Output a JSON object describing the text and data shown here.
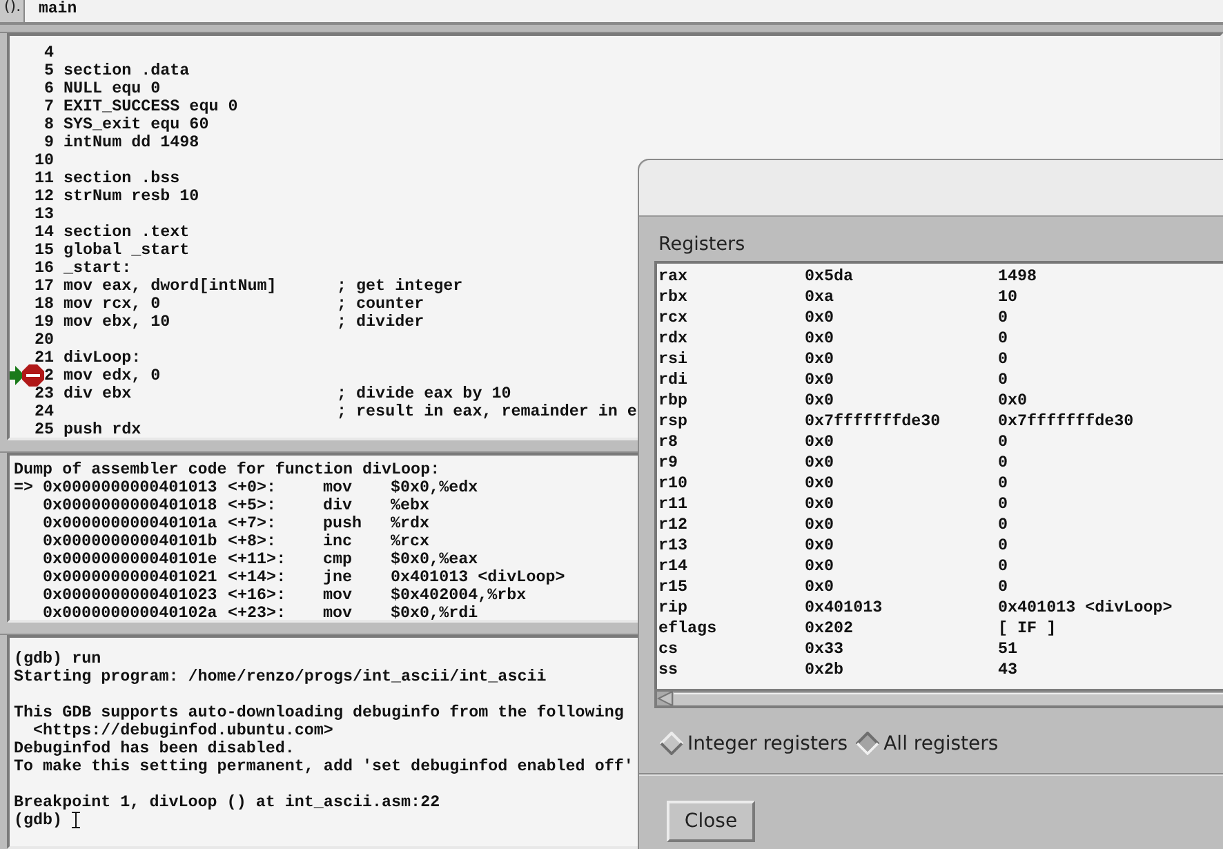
{
  "argument_field": {
    "label": "().",
    "value": "main"
  },
  "source": {
    "lines": [
      {
        "number": "4"
      },
      {
        "number": "5",
        "code": "section .data"
      },
      {
        "number": "6",
        "code": "NULL equ 0"
      },
      {
        "number": "7",
        "code": "EXIT_SUCCESS equ 0"
      },
      {
        "number": "8",
        "code": "SYS_exit equ 60"
      },
      {
        "number": "9",
        "code": "intNum dd 1498"
      },
      {
        "number": "10"
      },
      {
        "number": "11",
        "code": "section .bss"
      },
      {
        "number": "12",
        "code": "strNum resb 10"
      },
      {
        "number": "13"
      },
      {
        "number": "14",
        "code": "section .text"
      },
      {
        "number": "15",
        "code": "global _start"
      },
      {
        "number": "16",
        "code": "_start:"
      },
      {
        "number": "17",
        "code": "mov eax, dword[intNum]",
        "comment": "; get integer"
      },
      {
        "number": "18",
        "code": "mov rcx, 0",
        "comment": "; counter"
      },
      {
        "number": "19",
        "code": "mov ebx, 10",
        "comment": "; divider"
      },
      {
        "number": "20"
      },
      {
        "number": "21",
        "code": "divLoop:"
      },
      {
        "number": "2",
        "code": "mov edx, 0",
        "breakpoint": true,
        "current": true
      },
      {
        "number": "23",
        "code": "div ebx",
        "comment": "; divide eax by 10"
      },
      {
        "number": "24",
        "comment": "; result in eax, remainder in e"
      },
      {
        "number": "25",
        "code": "push rdx"
      }
    ]
  },
  "disassembly": {
    "title": "Dump of assembler code for function divLoop:",
    "lines": [
      {
        "marker": "=>",
        "address": "0x0000000000401013",
        "offset": "<+0>:",
        "mnemonic": "mov",
        "operands": "$0x0,%edx"
      },
      {
        "address": "0x0000000000401018",
        "offset": "<+5>:",
        "mnemonic": "div",
        "operands": "%ebx"
      },
      {
        "address": "0x000000000040101a",
        "offset": "<+7>:",
        "mnemonic": "push",
        "operands": "%rdx"
      },
      {
        "address": "0x000000000040101b",
        "offset": "<+8>:",
        "mnemonic": "inc",
        "operands": "%rcx"
      },
      {
        "address": "0x000000000040101e",
        "offset": "<+11>:",
        "mnemonic": "cmp",
        "operands": "$0x0,%eax"
      },
      {
        "address": "0x0000000000401021",
        "offset": "<+14>:",
        "mnemonic": "jne",
        "operands": "0x401013 <divLoop>"
      },
      {
        "address": "0x0000000000401023",
        "offset": "<+16>:",
        "mnemonic": "mov",
        "operands": "$0x402004,%rbx"
      },
      {
        "address": "0x000000000040102a",
        "offset": "<+23>:",
        "mnemonic": "mov",
        "operands": "$0x0,%rdi"
      }
    ]
  },
  "console": {
    "blocks": [
      [
        "(gdb) run",
        "Starting program: /home/renzo/progs/int_ascii/int_ascii"
      ],
      [
        "This GDB supports auto-downloading debuginfo from the following",
        "  <https://debuginfod.ubuntu.com>",
        "Debuginfod has been disabled.",
        "To make this setting permanent, add 'set debuginfod enabled off'"
      ],
      [
        "Breakpoint 1, divLoop () at int_ascii.asm:22"
      ]
    ],
    "prompt": "(gdb)"
  },
  "registers_dialog": {
    "title": "Registers",
    "rows": [
      [
        "rax",
        "0x5da",
        "1498"
      ],
      [
        "rbx",
        "0xa",
        "10"
      ],
      [
        "rcx",
        "0x0",
        "0"
      ],
      [
        "rdx",
        "0x0",
        "0"
      ],
      [
        "rsi",
        "0x0",
        "0"
      ],
      [
        "rdi",
        "0x0",
        "0"
      ],
      [
        "rbp",
        "0x0",
        "0x0"
      ],
      [
        "rsp",
        "0x7fffffffde30",
        "0x7fffffffde30"
      ],
      [
        "r8",
        "0x0",
        "0"
      ],
      [
        "r9",
        "0x0",
        "0"
      ],
      [
        "r10",
        "0x0",
        "0"
      ],
      [
        "r11",
        "0x0",
        "0"
      ],
      [
        "r12",
        "0x0",
        "0"
      ],
      [
        "r13",
        "0x0",
        "0"
      ],
      [
        "r14",
        "0x0",
        "0"
      ],
      [
        "r15",
        "0x0",
        "0"
      ],
      [
        "rip",
        "0x401013",
        "0x401013 <divLoop>"
      ],
      [
        "eflags",
        "0x202",
        "[ IF ]"
      ],
      [
        "cs",
        "0x33",
        "51"
      ],
      [
        "ss",
        "0x2b",
        "43"
      ]
    ],
    "options": [
      {
        "label": "Integer registers",
        "selected": false
      },
      {
        "label": "All registers",
        "selected": true
      }
    ],
    "close_button": "Close"
  }
}
